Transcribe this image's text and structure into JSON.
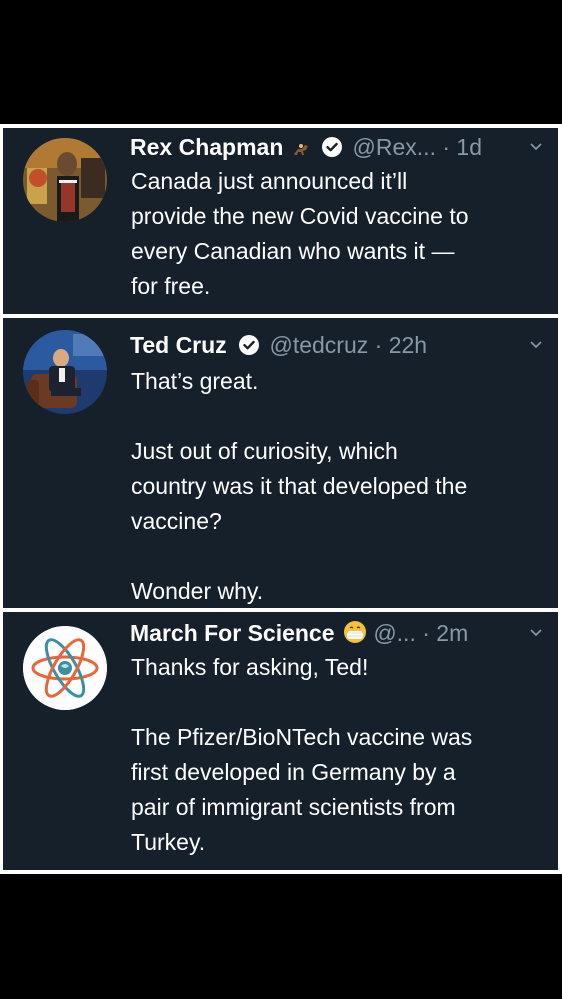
{
  "tweets": [
    {
      "name": "Rex Chapman",
      "name_emoji": "horse-racing-emoji",
      "handle": "@Rex...",
      "separator": "·",
      "time": "1d",
      "verified": true,
      "avatar": "rex-chapman-avatar",
      "body": [
        "Canada just announced it’ll",
        "provide the new Covid vaccine to",
        "every Canadian who wants it —",
        "for free."
      ]
    },
    {
      "name": "Ted Cruz",
      "handle": "@tedcruz",
      "separator": "·",
      "time": "22h",
      "verified": true,
      "avatar": "ted-cruz-avatar",
      "body": [
        "That’s great.",
        "",
        "Just out of curiosity, which",
        "country was it that developed the",
        "vaccine?",
        "",
        "Wonder why."
      ]
    },
    {
      "name": "March For Science",
      "name_emoji": "face-with-medical-mask-emoji",
      "handle": "@...",
      "separator": "·",
      "time": "2m",
      "verified": false,
      "avatar": "atom-logo-avatar",
      "body": [
        "Thanks for asking, Ted!",
        "",
        "The Pfizer/BioNTech vaccine was",
        "first developed in Germany by a",
        "pair of immigrant scientists from",
        "Turkey."
      ]
    }
  ],
  "icons": {
    "verified": "verified-badge-icon",
    "menu": "chevron-down-icon"
  },
  "colors": {
    "background": "#15202b",
    "text": "#ffffff",
    "secondary": "#8899a6",
    "atom_orange": "#e8663a",
    "atom_teal": "#3a8fa0"
  }
}
